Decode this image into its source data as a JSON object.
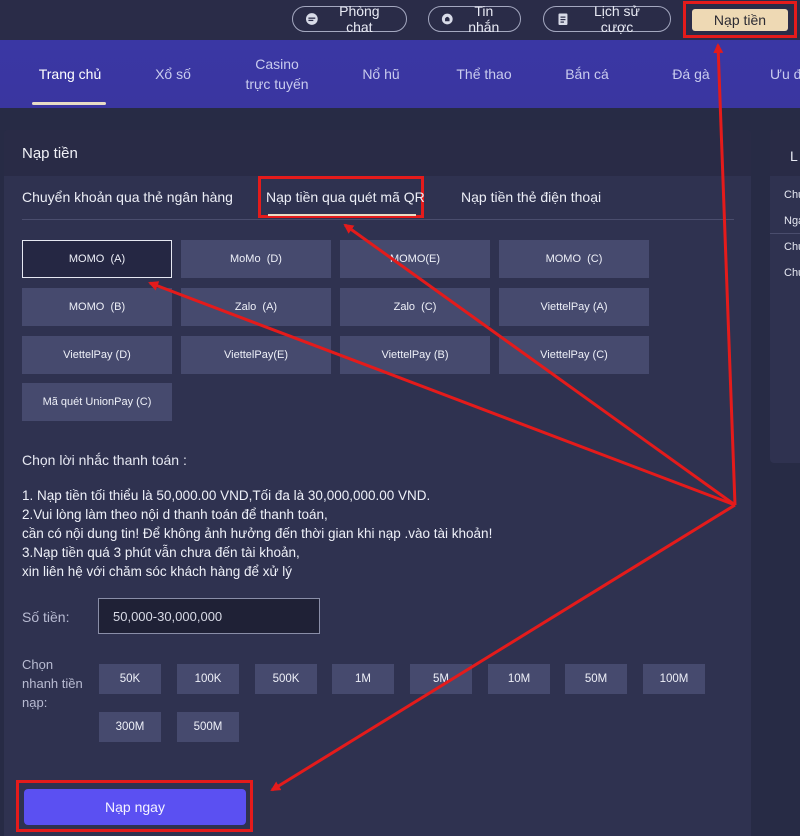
{
  "topbar": {
    "chat_room": "Phòng chat",
    "messages": "Tin nhắn",
    "bet_history": "Lịch sử cược",
    "deposit": "Nạp tiền"
  },
  "nav": {
    "items": [
      "Trang chủ",
      "Xổ số",
      "Casino",
      "trực tuyến",
      "Nổ hũ",
      "Thể thao",
      "Bắn cá",
      "Đá gà",
      "Ưu đ"
    ]
  },
  "panel": {
    "title": "Nạp tiền",
    "tabs": [
      "Chuyển khoản qua thẻ ngân hàng",
      "Nạp tiền qua quét mã QR",
      "Nạp tiền thẻ điện thoại"
    ],
    "methods": [
      "MOMO  (A)",
      "MoMo  (D)",
      "MOMO(E)",
      "MOMO  (C)",
      "MOMO  (B)",
      "Zalo  (A)",
      "Zalo  (C)",
      "ViettelPay (A)",
      "ViettelPay (D)",
      "ViettelPay(E)",
      "ViettelPay (B)",
      "ViettelPay (C)",
      "Mã quét UnionPay (C)"
    ],
    "notice_title": "Chọn lời nhắc thanh toán :",
    "notice_lines": [
      "1. Nạp tiền tối thiểu là 50,000.00 VND,Tối đa là 30,000,000.00 VND.",
      "2.Vui lòng làm theo nội d thanh toán để thanh toán,",
      "cần có nội dung tin! Để không ảnh hưởng đến thời gian khi nạp .vào tài khoản!",
      "3.Nạp tiền quá 3 phút vẫn chưa đến tài khoản,",
      "xin liên hệ với chăm sóc khách hàng để xử lý"
    ],
    "amount_label": "Số tiền:",
    "amount_placeholder": "50,000-30,000,000",
    "quick_label": "Chọn nhanh tiền nạp:",
    "quick_amounts": [
      "50K",
      "100K",
      "500K",
      "1M",
      "5M",
      "10M",
      "50M",
      "100M",
      "300M",
      "500M"
    ],
    "submit": "Nạp ngay"
  },
  "side": {
    "head": "L",
    "lines": [
      "Chu",
      "Nga",
      "Chu",
      "Chu"
    ]
  }
}
